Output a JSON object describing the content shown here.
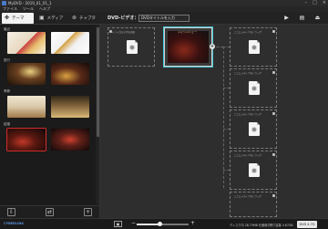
{
  "window": {
    "title": "MyDVD - 2019_01_01_1"
  },
  "menubar": [
    "ファイル",
    "ツール",
    "ヘルプ"
  ],
  "tabs": [
    {
      "label": "テーマ",
      "icon": "theme-icon",
      "active": true
    },
    {
      "label": "メディア",
      "icon": "media-icon",
      "active": false
    },
    {
      "label": "チャプタ",
      "icon": "chapter-icon",
      "active": false
    }
  ],
  "sidebar": {
    "sections": [
      "最近",
      "旅行",
      "季節",
      "結婚"
    ]
  },
  "topbar": {
    "dvd_label": "DVD-ビデオ：",
    "dvd_title_value": "DVDタイトルを入力",
    "play_icon": "play-icon",
    "save_icon": "save-icon",
    "burn_icon": "burn-icon"
  },
  "canvas": {
    "intro_card_label": "イントロビデオを追加",
    "main_menu_title": "メインメニュー",
    "right_card_labels": [
      "ここにメディアをドラッグ",
      "ここにメディアをドラッグ",
      "ここにメディアをドラッグ",
      "ここにメディアをドラッグ",
      "ここにメディアをドラッグ"
    ]
  },
  "statusbar": {
    "brand": "CYBERLINK",
    "zoom_level": 0.45,
    "disc_usage": "ディスク中 28.75MB を使用中",
    "remaining": "残り容量 4.67GB",
    "disc_type": "DVD 4.7G"
  },
  "colors": {
    "accent": "#49c7d8",
    "selected": "#cf2b2b",
    "brand": "#5b8fd8"
  }
}
